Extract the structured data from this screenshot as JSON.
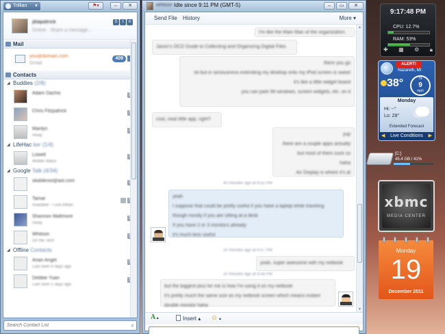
{
  "trillian": {
    "menu_label": "Trillian",
    "section_mail": "Mail",
    "mail_badge": "409",
    "section_contacts": "Contacts",
    "groups": {
      "buddies": "Buddies",
      "lifehacker": "LifeHac",
      "google": "Google",
      "offline": "Offline"
    },
    "search_placeholder": "Search Contact List"
  },
  "chat": {
    "status": "Idle since 9:11 PM (GMT-5)",
    "toolbar": {
      "send_file": "Send File",
      "history": "History",
      "more": "More"
    },
    "format": {
      "font_glyph": "A",
      "insert": "Insert",
      "emoticon": "☺"
    },
    "input_value": ""
  },
  "gadgets": {
    "clock": {
      "time": "9:17:48 PM",
      "cpu_label": "CPU: 12.7%",
      "cpu_fraction": 0.127,
      "ram_label": "RAM: 53%",
      "ram_fraction": 0.53
    },
    "weather": {
      "alert": "ALERT!",
      "city": "Nazareth, MI",
      "temperature": "38°",
      "wind_dir": "N",
      "wind_speed": "9",
      "wind_unit": "mph",
      "day": "Monday",
      "hi": "Hi: --°",
      "lo": "Lo: 28°",
      "extended": "Extended Forecast",
      "live": "Live Conditions"
    },
    "drive": {
      "label": "[C:]",
      "info": "45.4 GB / 41%",
      "fraction": 0.41
    },
    "xbmc": {
      "logo": "xbmc",
      "tagline": "MEDIA CENTER"
    },
    "calendar": {
      "weekday": "Monday",
      "day_number": "19",
      "month_year": "December 2011"
    }
  }
}
